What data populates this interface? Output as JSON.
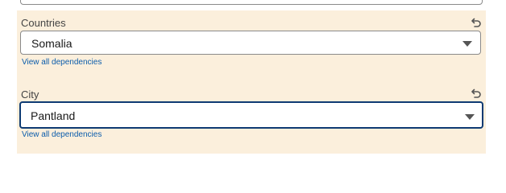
{
  "fields": [
    {
      "label": "Countries",
      "value": "Somalia",
      "dependencies_link": "View all dependencies"
    },
    {
      "label": "City",
      "value": "Pantland",
      "dependencies_link": "View all dependencies"
    }
  ],
  "colors": {
    "panel_background": "#fbefdc",
    "link": "#0b5cab",
    "focus_border": "#0e3b73"
  },
  "icons": {
    "reset": "undo-icon",
    "dropdown": "chevron-down-icon"
  }
}
